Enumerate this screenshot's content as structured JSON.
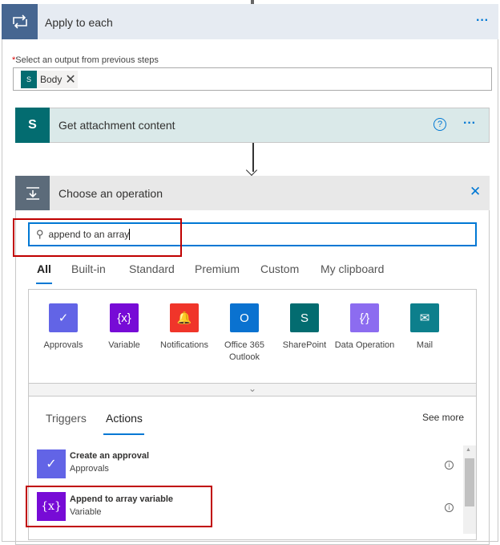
{
  "apply": {
    "title": "Apply to each",
    "more": "···",
    "required_mark": "*",
    "field_label": "Select an output from previous steps",
    "token": "Body",
    "token_remove": "✕"
  },
  "attachment": {
    "title": "Get attachment content",
    "help": "?",
    "more": "···"
  },
  "choose": {
    "title": "Choose an operation",
    "close": "✕",
    "search_value": "append to an array",
    "tabs": [
      "All",
      "Built-in",
      "Standard",
      "Premium",
      "Custom",
      "My clipboard"
    ],
    "active_tab": "All",
    "connectors": [
      {
        "label": "Approvals",
        "color": "#6264e6",
        "glyph": "✓"
      },
      {
        "label": "Variable",
        "color": "#770bd6",
        "glyph": "{x}"
      },
      {
        "label": "Notifications",
        "color": "#f0352a",
        "glyph": "🔔"
      },
      {
        "label": "Office 365 Outlook",
        "color": "#0a72d0",
        "glyph": "O"
      },
      {
        "label": "SharePoint",
        "color": "#036c70",
        "glyph": "S"
      },
      {
        "label": "Data Operation",
        "color": "#8c6cf0",
        "glyph": "{∕}"
      },
      {
        "label": "Mail",
        "color": "#0d7f8c",
        "glyph": "✉"
      }
    ],
    "collapse": "⌄",
    "sub_tabs": [
      "Triggers",
      "Actions"
    ],
    "active_sub_tab": "Actions",
    "see_more": "See more",
    "actions": [
      {
        "title": "Create an approval",
        "subtitle": "Approvals",
        "color": "#6264e6",
        "glyph": "✓",
        "info": "i"
      },
      {
        "title": "Append to array variable",
        "subtitle": "Variable",
        "color": "#770bd6",
        "glyph": "{x}",
        "info": "i"
      }
    ]
  }
}
